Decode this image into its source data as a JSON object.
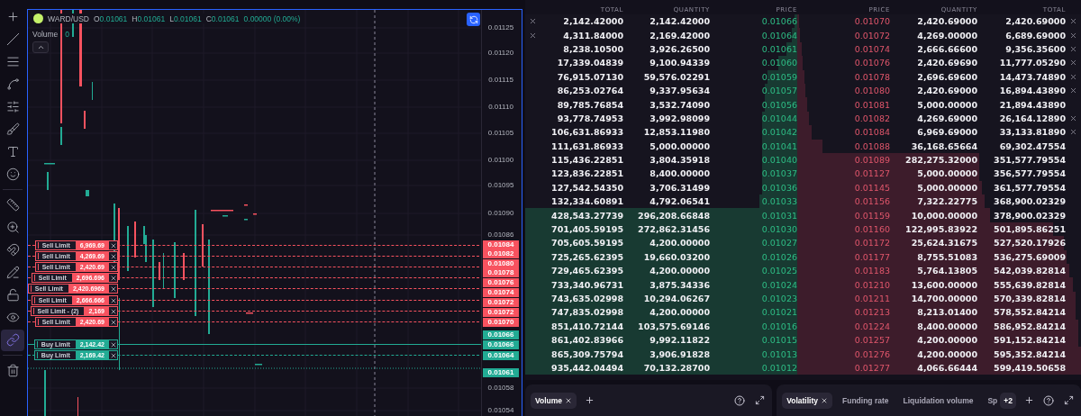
{
  "toolbar": {
    "tools": [
      {
        "selected": false
      },
      {
        "selected": false
      },
      {
        "selected": false
      },
      {
        "selected": false
      },
      {
        "selected": false
      },
      {
        "selected": false
      },
      {
        "selected": false
      },
      {
        "selected": false
      },
      {
        "selected": false
      },
      {
        "selected": false
      },
      {
        "selected": false
      },
      {
        "selected": false
      },
      {
        "selected": false
      },
      {
        "selected": false
      },
      {
        "selected": true
      },
      {
        "selected": false
      }
    ]
  },
  "chart": {
    "symbol": "WARD/USD",
    "ohlc": [
      {
        "label": "O",
        "value": "0.01061"
      },
      {
        "label": "H",
        "value": "0.01061"
      },
      {
        "label": "L",
        "value": "0.01061"
      },
      {
        "label": "C",
        "value": "0.01061"
      }
    ],
    "change": "0.00000 (0.00%)",
    "volume": {
      "label": "Volume",
      "value": "0"
    },
    "price_axis": [
      {
        "kind": "plain",
        "price": "0.01125"
      },
      {
        "kind": "plain",
        "price": "0.01120"
      },
      {
        "kind": "plain",
        "price": "0.01115"
      },
      {
        "kind": "plain",
        "price": "0.01110"
      },
      {
        "kind": "plain",
        "price": "0.01105"
      },
      {
        "kind": "plain",
        "price": "0.01100"
      },
      {
        "kind": "plain",
        "price": "0.01095"
      },
      {
        "kind": "plain",
        "price": "0.01090"
      },
      {
        "kind": "plain",
        "price": "0.01086"
      },
      {
        "kind": "sell",
        "price": "0.01084"
      },
      {
        "kind": "sell",
        "price": "0.01082"
      },
      {
        "kind": "sell",
        "price": "0.01080"
      },
      {
        "kind": "sell",
        "price": "0.01078"
      },
      {
        "kind": "sell",
        "price": "0.01076"
      },
      {
        "kind": "sell",
        "price": "0.01074"
      },
      {
        "kind": "sell",
        "price": "0.01072"
      },
      {
        "kind": "sell",
        "price": "0.01072"
      },
      {
        "kind": "sell",
        "price": "0.01070"
      },
      {
        "kind": "buy",
        "price": "0.01066"
      },
      {
        "kind": "buy",
        "price": "0.01066"
      },
      {
        "kind": "buy",
        "price": "0.01064"
      },
      {
        "kind": "last",
        "price": "0.01061"
      },
      {
        "kind": "plain",
        "price": "0.01058"
      },
      {
        "kind": "plain",
        "price": "0.01054"
      }
    ],
    "orders": [
      {
        "kind": "sell",
        "label": "Sell Limit",
        "quantity": "6,969.69",
        "active": false
      },
      {
        "kind": "sell",
        "label": "Sell Limit",
        "quantity": "4,269.69",
        "active": false
      },
      {
        "kind": "sell",
        "label": "Sell Limit",
        "quantity": "2,420.69",
        "active": false
      },
      {
        "kind": "sell",
        "label": "Sell Limit",
        "quantity": "2,696.696",
        "active": false
      },
      {
        "kind": "sell",
        "label": "Sell Limit",
        "quantity": "2,420.6969",
        "active": false
      },
      {
        "kind": "sell",
        "label": "Sell Limit",
        "quantity": "2,666.666",
        "active": false
      },
      {
        "kind": "sell",
        "label": "Sell Limit - (2)",
        "quantity": "2,169",
        "active": false
      },
      {
        "kind": "sell",
        "label": "Sell Limit",
        "quantity": "2,420.69",
        "active": false
      },
      {
        "kind": "buy",
        "label": "Buy Limit",
        "quantity": "2,142.42",
        "active": true
      },
      {
        "kind": "buy",
        "label": "Buy Limit",
        "quantity": "2,169.42",
        "active": false
      }
    ]
  },
  "order_book": {
    "columns": [
      "TOTAL",
      "QUANTITY",
      "PRICE",
      "PRICE",
      "QUANTITY",
      "TOTAL"
    ],
    "rows": [
      {
        "bid": {
          "total": "2,142.42000",
          "quantity": "2,142.42000",
          "price": "0.01066",
          "level": 0.01,
          "cancel": true
        },
        "ask": {
          "price": "0.01070",
          "quantity": "2,420.69000",
          "total": "2,420.69000",
          "level": 0.005,
          "cancel": true
        }
      },
      {
        "bid": {
          "total": "4,311.84000",
          "quantity": "2,169.42000",
          "price": "0.01064",
          "level": 0.02,
          "cancel": true
        },
        "ask": {
          "price": "0.01072",
          "quantity": "4,269.00000",
          "total": "6,689.69000",
          "level": 0.01,
          "cancel": true
        }
      },
      {
        "bid": {
          "total": "8,238.10500",
          "quantity": "3,926.26500",
          "price": "0.01061",
          "level": 0.04,
          "cancel": false
        },
        "ask": {
          "price": "0.01074",
          "quantity": "2,666.66600",
          "total": "9,356.35600",
          "level": 0.015,
          "cancel": true
        }
      },
      {
        "bid": {
          "total": "17,339.04839",
          "quantity": "9,100.94339",
          "price": "0.01060",
          "level": 0.07,
          "cancel": false
        },
        "ask": {
          "price": "0.01076",
          "quantity": "2,420.69690",
          "total": "11,777.05290",
          "level": 0.02,
          "cancel": true
        }
      },
      {
        "bid": {
          "total": "76,915.07130",
          "quantity": "59,576.02291",
          "price": "0.01059",
          "level": 0.11,
          "cancel": false
        },
        "ask": {
          "price": "0.01078",
          "quantity": "2,696.69600",
          "total": "14,473.74890",
          "level": 0.025,
          "cancel": true
        }
      },
      {
        "bid": {
          "total": "86,253.02764",
          "quantity": "9,337.95634",
          "price": "0.01057",
          "level": 0.12,
          "cancel": false
        },
        "ask": {
          "price": "0.01080",
          "quantity": "2,420.69000",
          "total": "16,894.43890",
          "level": 0.03,
          "cancel": true
        }
      },
      {
        "bid": {
          "total": "89,785.76854",
          "quantity": "3,532.74090",
          "price": "0.01056",
          "level": 0.12,
          "cancel": false
        },
        "ask": {
          "price": "0.01081",
          "quantity": "5,000.00000",
          "total": "21,894.43890",
          "level": 0.035,
          "cancel": false
        }
      },
      {
        "bid": {
          "total": "93,778.74953",
          "quantity": "3,992.98099",
          "price": "0.01044",
          "level": 0.13,
          "cancel": false
        },
        "ask": {
          "price": "0.01082",
          "quantity": "4,269.69000",
          "total": "26,164.12890",
          "level": 0.04,
          "cancel": true
        }
      },
      {
        "bid": {
          "total": "106,631.86933",
          "quantity": "12,853.11980",
          "price": "0.01042",
          "level": 0.13,
          "cancel": false
        },
        "ask": {
          "price": "0.01084",
          "quantity": "6,969.69000",
          "total": "33,133.81890",
          "level": 0.05,
          "cancel": true
        }
      },
      {
        "bid": {
          "total": "111,631.86933",
          "quantity": "5,000.00000",
          "price": "0.01041",
          "level": 0.13,
          "cancel": false
        },
        "ask": {
          "price": "0.01088",
          "quantity": "36,168.65664",
          "total": "69,302.47554",
          "level": 0.09,
          "cancel": false
        }
      },
      {
        "bid": {
          "total": "115,436.22851",
          "quantity": "3,804.35918",
          "price": "0.01040",
          "level": 0.13,
          "cancel": false
        },
        "ask": {
          "price": "0.01089",
          "quantity": "282,275.32000",
          "total": "351,577.79554",
          "level": 0.64,
          "cancel": false
        }
      },
      {
        "bid": {
          "total": "123,836.22851",
          "quantity": "8,400.00000",
          "price": "0.01037",
          "level": 0.13,
          "cancel": false
        },
        "ask": {
          "price": "0.01127",
          "quantity": "5,000.00000",
          "total": "356,577.79554",
          "level": 0.64,
          "cancel": false
        }
      },
      {
        "bid": {
          "total": "127,542.54350",
          "quantity": "3,706.31499",
          "price": "0.01036",
          "level": 0.13,
          "cancel": false
        },
        "ask": {
          "price": "0.01145",
          "quantity": "5,000.00000",
          "total": "361,577.79554",
          "level": 0.65,
          "cancel": false
        }
      },
      {
        "bid": {
          "total": "132,334.60891",
          "quantity": "4,792.06541",
          "price": "0.01033",
          "level": 0.14,
          "cancel": false
        },
        "ask": {
          "price": "0.01156",
          "quantity": "7,322.22775",
          "total": "368,900.02329",
          "level": 0.66,
          "cancel": false
        }
      },
      {
        "bid": {
          "total": "428,543.27739",
          "quantity": "296,208.66848",
          "price": "0.01031",
          "level": 1,
          "cancel": false
        },
        "ask": {
          "price": "0.01159",
          "quantity": "10,000.00000",
          "total": "378,900.02329",
          "level": 0.68,
          "cancel": false
        }
      },
      {
        "bid": {
          "total": "701,405.59195",
          "quantity": "272,862.31456",
          "price": "0.01030",
          "level": 1,
          "cancel": false
        },
        "ask": {
          "price": "0.01160",
          "quantity": "122,995.83922",
          "total": "501,895.86251",
          "level": 0.9,
          "cancel": false
        }
      },
      {
        "bid": {
          "total": "705,605.59195",
          "quantity": "4,200.00000",
          "price": "0.01027",
          "level": 1,
          "cancel": false
        },
        "ask": {
          "price": "0.01172",
          "quantity": "25,624.31675",
          "total": "527,520.17926",
          "level": 0.94,
          "cancel": false
        }
      },
      {
        "bid": {
          "total": "725,265.62395",
          "quantity": "19,660.03200",
          "price": "0.01026",
          "level": 1,
          "cancel": false
        },
        "ask": {
          "price": "0.01177",
          "quantity": "8,755.51083",
          "total": "536,275.69009",
          "level": 0.95,
          "cancel": false
        }
      },
      {
        "bid": {
          "total": "729,465.62395",
          "quantity": "4,200.00000",
          "price": "0.01025",
          "level": 1,
          "cancel": false
        },
        "ask": {
          "price": "0.01183",
          "quantity": "5,764.13805",
          "total": "542,039.82814",
          "level": 0.96,
          "cancel": false
        }
      },
      {
        "bid": {
          "total": "733,340.96731",
          "quantity": "3,875.34336",
          "price": "0.01024",
          "level": 1,
          "cancel": false
        },
        "ask": {
          "price": "0.01210",
          "quantity": "13,600.00000",
          "total": "555,639.82814",
          "level": 0.97,
          "cancel": false
        }
      },
      {
        "bid": {
          "total": "743,635.02998",
          "quantity": "10,294.06267",
          "price": "0.01023",
          "level": 1,
          "cancel": false
        },
        "ask": {
          "price": "0.01211",
          "quantity": "14,700.00000",
          "total": "570,339.82814",
          "level": 0.98,
          "cancel": false
        }
      },
      {
        "bid": {
          "total": "747,835.02998",
          "quantity": "4,200.00000",
          "price": "0.01021",
          "level": 1,
          "cancel": false
        },
        "ask": {
          "price": "0.01213",
          "quantity": "8,213.01400",
          "total": "578,552.84214",
          "level": 0.98,
          "cancel": false
        }
      },
      {
        "bid": {
          "total": "851,410.72144",
          "quantity": "103,575.69146",
          "price": "0.01016",
          "level": 1,
          "cancel": false
        },
        "ask": {
          "price": "0.01224",
          "quantity": "8,400.00000",
          "total": "586,952.84214",
          "level": 0.99,
          "cancel": false
        }
      },
      {
        "bid": {
          "total": "861,402.83966",
          "quantity": "9,992.11822",
          "price": "0.01015",
          "level": 1,
          "cancel": false
        },
        "ask": {
          "price": "0.01257",
          "quantity": "4,200.00000",
          "total": "591,152.84214",
          "level": 0.99,
          "cancel": false
        }
      },
      {
        "bid": {
          "total": "865,309.75794",
          "quantity": "3,906.91828",
          "price": "0.01013",
          "level": 1,
          "cancel": false
        },
        "ask": {
          "price": "0.01276",
          "quantity": "4,200.00000",
          "total": "595,352.84214",
          "level": 1,
          "cancel": false
        }
      },
      {
        "bid": {
          "total": "935,442.04494",
          "quantity": "70,132.28700",
          "price": "0.01012",
          "level": 1,
          "cancel": false
        },
        "ask": {
          "price": "0.01277",
          "quantity": "4,066.66444",
          "total": "599,419.50658",
          "level": 1,
          "cancel": false
        }
      }
    ]
  },
  "panels": [
    {
      "tabs": [
        {
          "label": "Volume",
          "selected": true
        }
      ]
    },
    {
      "tabs": [
        {
          "label": "Volatility",
          "selected": true
        },
        {
          "label": "Funding rate",
          "selected": false
        },
        {
          "label": "Liquidation volume",
          "selected": false
        },
        {
          "label": "Sp",
          "selected": false
        }
      ],
      "more": "+2"
    }
  ]
}
